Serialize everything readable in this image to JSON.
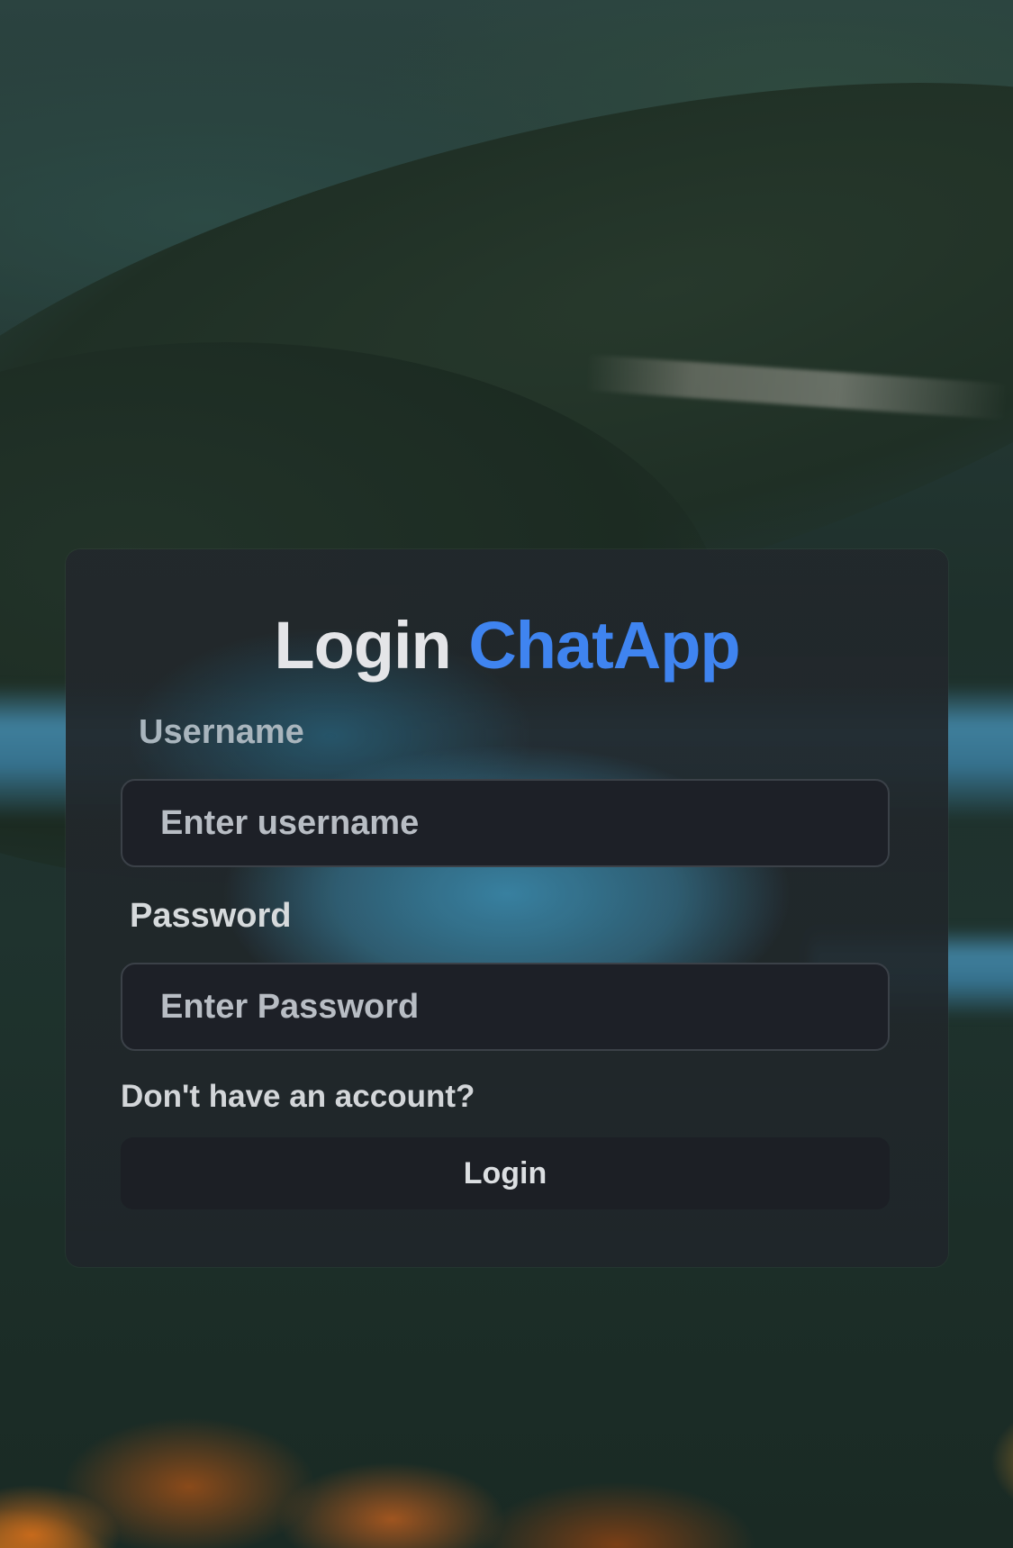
{
  "app": {
    "title_prefix": "Login",
    "title_brand": "ChatApp",
    "brand_color": "#3f84f0"
  },
  "form": {
    "username_label": "Username",
    "username_placeholder": "Enter username",
    "username_value": "",
    "password_label": "Password",
    "password_placeholder": "Enter Password",
    "password_value": "",
    "signup_link": "Don't have an account?",
    "submit_label": "Login"
  }
}
